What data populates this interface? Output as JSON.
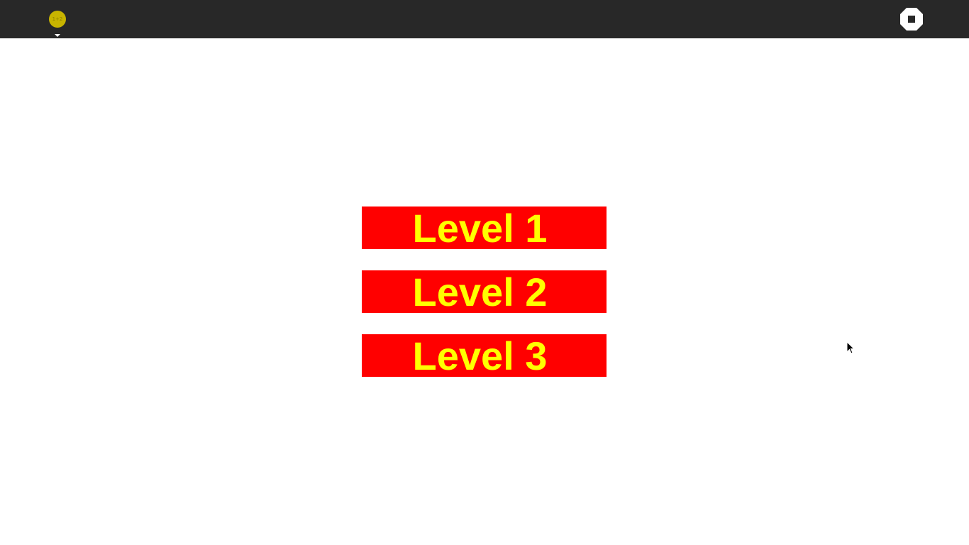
{
  "toolbar": {
    "activity_icon": "activity-icon",
    "activity_icon_text": "1+2",
    "activity_icon_color": "#c8b400",
    "background_color": "#282828",
    "stop_icon": "stop-icon"
  },
  "levels": [
    {
      "label": "Level 1"
    },
    {
      "label": "Level 2"
    },
    {
      "label": "Level 3"
    }
  ],
  "colors": {
    "button_background": "#ff0000",
    "button_text": "#ffff00",
    "canvas": "#ffffff"
  }
}
